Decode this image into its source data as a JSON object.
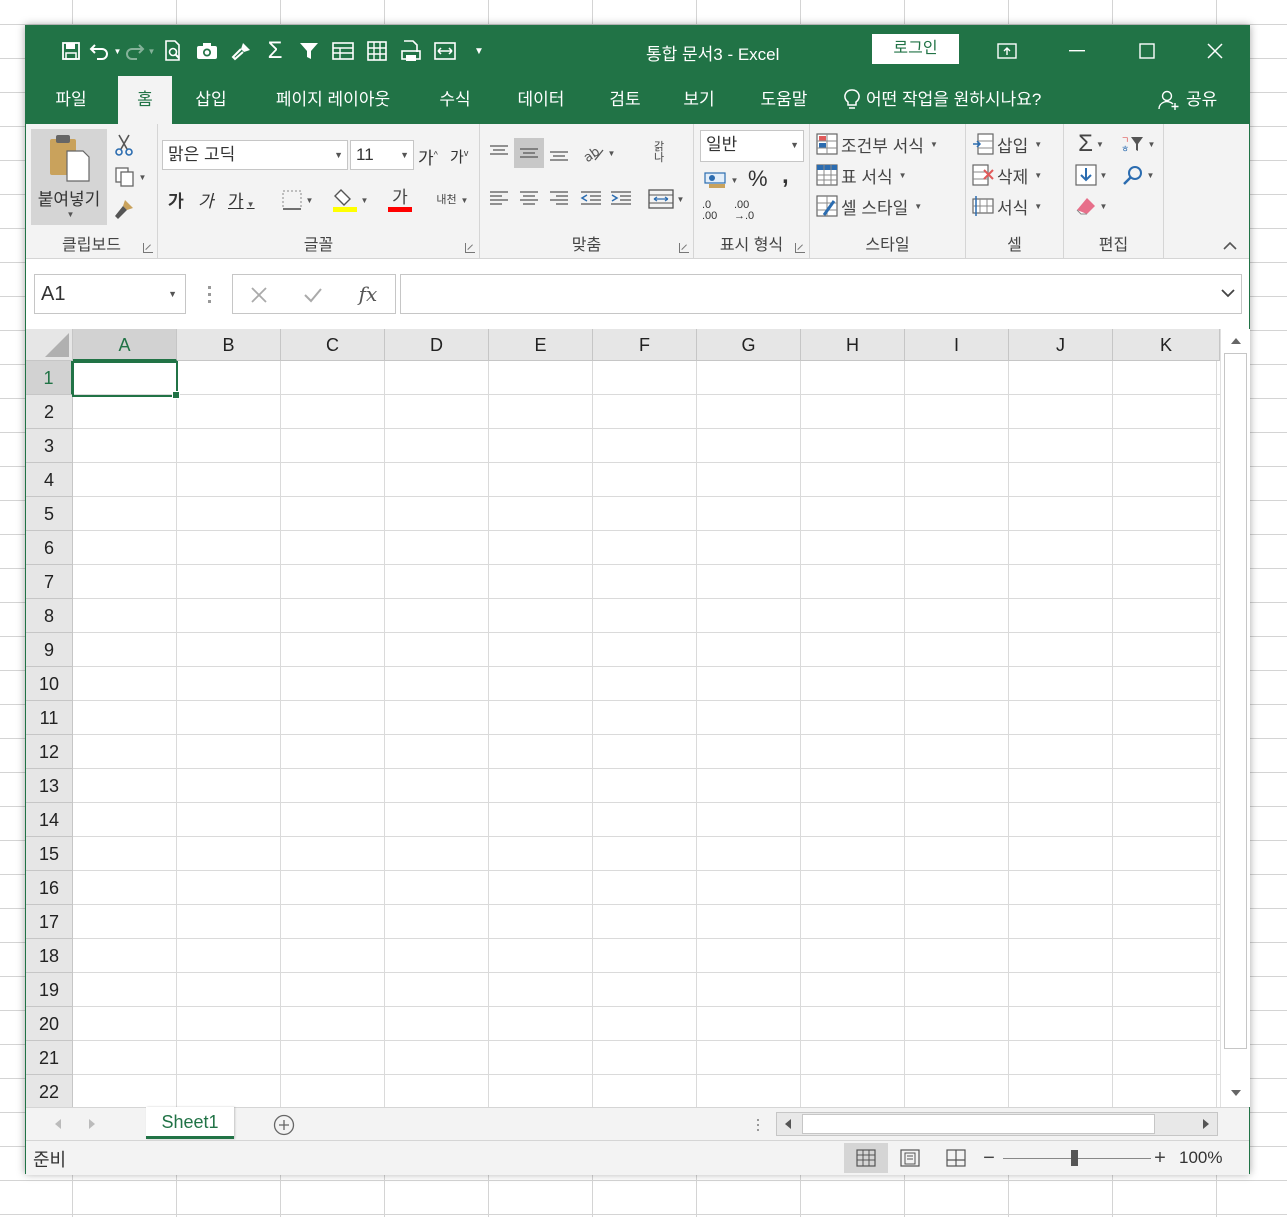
{
  "window": {
    "doc_title": "통합 문서3  -  Excel",
    "login": "로그인",
    "colors": {
      "accent": "#217346",
      "ribbon": "#f3f3f3"
    }
  },
  "quick_access": [
    "save-icon",
    "undo-icon",
    "redo-icon",
    "print-preview-icon",
    "camera-icon",
    "format-painter-icon",
    "autosum-icon",
    "filter-icon",
    "form-icon",
    "table-icon",
    "print-icon",
    "page-setup-icon",
    "customize-icon"
  ],
  "tabs": [
    "파일",
    "홈",
    "삽입",
    "페이지 레이아웃",
    "수식",
    "데이터",
    "검토",
    "보기",
    "도움말"
  ],
  "active_tab": "홈",
  "tell_me": "어떤 작업을 원하시나요?",
  "share": "공유",
  "ribbon": {
    "clipboard": {
      "paste": "붙여넣기",
      "label": "클립보드"
    },
    "font": {
      "font_name": "맑은 고딕",
      "font_size": "11",
      "grow": "가",
      "shrink": "가",
      "bold": "가",
      "italic": "가",
      "underline": "가",
      "font_color_letter": "가",
      "phonetic": "내천",
      "label": "글꼴"
    },
    "alignment": {
      "wrap": "갉나",
      "label": "맞춤"
    },
    "number": {
      "format": "일반",
      "percent": "%",
      "comma": ",",
      "inc_decimal": ".0 .00",
      "dec_decimal": ".00 →.0",
      "label": "표시 형식"
    },
    "styles": {
      "conditional": "조건부 서식",
      "table": "표 서식",
      "cell_style": "셀 스타일",
      "label": "스타일"
    },
    "cells": {
      "insert": "삽입",
      "delete": "삭제",
      "format": "서식",
      "label": "셀"
    },
    "editing": {
      "label": "편집"
    }
  },
  "formula_bar": {
    "name_box": "A1",
    "fx": "fx",
    "formula": ""
  },
  "columns": [
    "A",
    "B",
    "C",
    "D",
    "E",
    "F",
    "G",
    "H",
    "I",
    "J",
    "K"
  ],
  "rows": [
    "1",
    "2",
    "3",
    "4",
    "5",
    "6",
    "7",
    "8",
    "9",
    "10",
    "11",
    "12",
    "13",
    "14",
    "15",
    "16",
    "17",
    "18",
    "19",
    "20",
    "21",
    "22"
  ],
  "selected_cell": "A1",
  "sheets": [
    "Sheet1"
  ],
  "active_sheet": "Sheet1",
  "status": {
    "ready": "준비",
    "zoom": "100%",
    "zoom_level": 100
  }
}
